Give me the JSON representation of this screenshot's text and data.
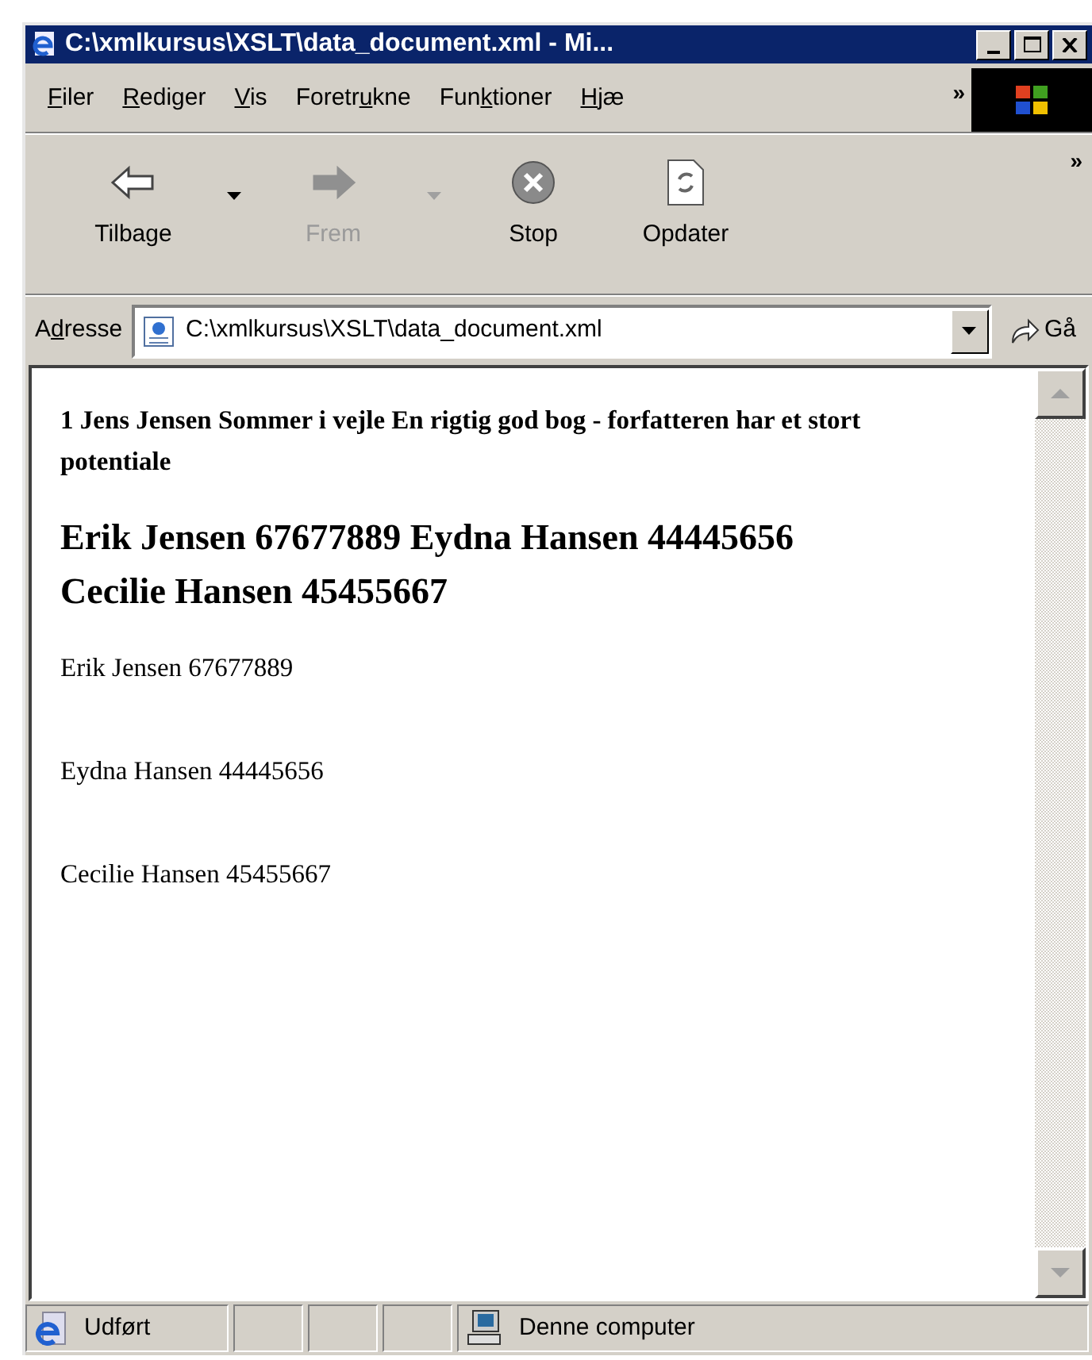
{
  "window": {
    "title": "C:\\xmlkursus\\XSLT\\data_document.xml - Mi..."
  },
  "menu": [
    {
      "key": "F",
      "after": "iler"
    },
    {
      "key": "R",
      "after": "ediger"
    },
    {
      "key": "V",
      "after": "is"
    },
    {
      "before": "Foretr",
      "key": "u",
      "after": "kne"
    },
    {
      "before": "Fun",
      "key": "k",
      "after": "tioner"
    },
    {
      "key": "H",
      "after": "jæ"
    }
  ],
  "menu_overflow": "»",
  "toolbar": [
    {
      "kind": "back",
      "label": "Tilbage",
      "disabled": false,
      "dropdown": true
    },
    {
      "kind": "forward",
      "label": "Frem",
      "disabled": true,
      "dropdown": true
    },
    {
      "kind": "stop",
      "label": "Stop",
      "disabled": false,
      "dropdown": false
    },
    {
      "kind": "refresh",
      "label": "Opdater",
      "disabled": false,
      "dropdown": false
    }
  ],
  "toolbar_overflow": "»",
  "address": {
    "label": {
      "before": "A",
      "key": "d",
      "after": "resse"
    },
    "value": "C:\\xmlkursus\\XSLT\\data_document.xml",
    "go": "Gå"
  },
  "content": [
    {
      "kind": "h4",
      "text": "1 Jens Jensen Sommer i vejle En rigtig god bog - forfatteren har et stort potentiale"
    },
    {
      "kind": "h2",
      "text": "Erik Jensen 67677889 Eydna Hansen 44445656 Cecilie Hansen 45455667"
    },
    {
      "kind": "p",
      "text": "Erik Jensen 67677889"
    },
    {
      "kind": "p",
      "text": "Eydna Hansen 44445656"
    },
    {
      "kind": "p",
      "text": "Cecilie Hansen 45455667"
    }
  ],
  "status_bar": {
    "status": "Udført",
    "zone": "Denne computer"
  }
}
